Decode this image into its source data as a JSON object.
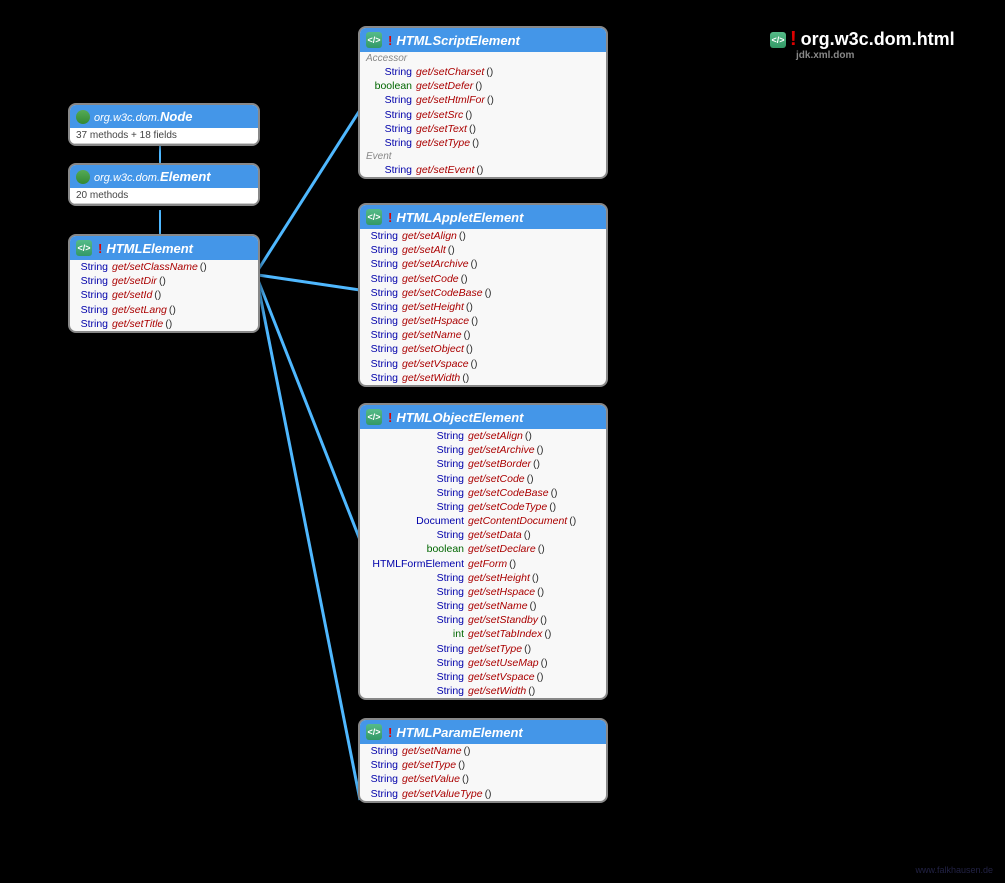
{
  "package_title": "org.w3c.dom.html",
  "package_sub": "jdk.xml.dom",
  "watermark": "www.falkhausen.de",
  "nodes": {
    "node": {
      "prefix": "org.w3c.dom.",
      "name": "Node",
      "sub": "37 methods + 18 fields"
    },
    "element": {
      "prefix": "org.w3c.dom.",
      "name": "Element",
      "sub": "20 methods"
    },
    "htmlelement": {
      "name": "HTMLElement",
      "methods": [
        {
          "type": "String",
          "name": "get/setClassName",
          "prim": false
        },
        {
          "type": "String",
          "name": "get/setDir",
          "prim": false
        },
        {
          "type": "String",
          "name": "get/setId",
          "prim": false
        },
        {
          "type": "String",
          "name": "get/setLang",
          "prim": false
        },
        {
          "type": "String",
          "name": "get/setTitle",
          "prim": false
        }
      ]
    },
    "script": {
      "name": "HTMLScriptElement",
      "sections": [
        {
          "label": "Accessor",
          "methods": [
            {
              "type": "String",
              "name": "get/setCharset",
              "prim": false
            },
            {
              "type": "boolean",
              "name": "get/setDefer",
              "prim": true
            },
            {
              "type": "String",
              "name": "get/setHtmlFor",
              "prim": false
            },
            {
              "type": "String",
              "name": "get/setSrc",
              "prim": false
            },
            {
              "type": "String",
              "name": "get/setText",
              "prim": false
            },
            {
              "type": "String",
              "name": "get/setType",
              "prim": false
            }
          ]
        },
        {
          "label": "Event",
          "methods": [
            {
              "type": "String",
              "name": "get/setEvent",
              "prim": false
            }
          ]
        }
      ]
    },
    "applet": {
      "name": "HTMLAppletElement",
      "methods": [
        {
          "type": "String",
          "name": "get/setAlign",
          "prim": false
        },
        {
          "type": "String",
          "name": "get/setAlt",
          "prim": false
        },
        {
          "type": "String",
          "name": "get/setArchive",
          "prim": false
        },
        {
          "type": "String",
          "name": "get/setCode",
          "prim": false
        },
        {
          "type": "String",
          "name": "get/setCodeBase",
          "prim": false
        },
        {
          "type": "String",
          "name": "get/setHeight",
          "prim": false
        },
        {
          "type": "String",
          "name": "get/setHspace",
          "prim": false
        },
        {
          "type": "String",
          "name": "get/setName",
          "prim": false
        },
        {
          "type": "String",
          "name": "get/setObject",
          "prim": false
        },
        {
          "type": "String",
          "name": "get/setVspace",
          "prim": false
        },
        {
          "type": "String",
          "name": "get/setWidth",
          "prim": false
        }
      ]
    },
    "object": {
      "name": "HTMLObjectElement",
      "methods": [
        {
          "type": "String",
          "name": "get/setAlign",
          "prim": false
        },
        {
          "type": "String",
          "name": "get/setArchive",
          "prim": false
        },
        {
          "type": "String",
          "name": "get/setBorder",
          "prim": false
        },
        {
          "type": "String",
          "name": "get/setCode",
          "prim": false
        },
        {
          "type": "String",
          "name": "get/setCodeBase",
          "prim": false
        },
        {
          "type": "String",
          "name": "get/setCodeType",
          "prim": false
        },
        {
          "type": "Document",
          "name": "getContentDocument",
          "prim": false
        },
        {
          "type": "String",
          "name": "get/setData",
          "prim": false
        },
        {
          "type": "boolean",
          "name": "get/setDeclare",
          "prim": true
        },
        {
          "type": "HTMLFormElement",
          "name": "getForm",
          "prim": false
        },
        {
          "type": "String",
          "name": "get/setHeight",
          "prim": false
        },
        {
          "type": "String",
          "name": "get/setHspace",
          "prim": false
        },
        {
          "type": "String",
          "name": "get/setName",
          "prim": false
        },
        {
          "type": "String",
          "name": "get/setStandby",
          "prim": false
        },
        {
          "type": "int",
          "name": "get/setTabIndex",
          "prim": true
        },
        {
          "type": "String",
          "name": "get/setType",
          "prim": false
        },
        {
          "type": "String",
          "name": "get/setUseMap",
          "prim": false
        },
        {
          "type": "String",
          "name": "get/setVspace",
          "prim": false
        },
        {
          "type": "String",
          "name": "get/setWidth",
          "prim": false
        }
      ]
    },
    "param": {
      "name": "HTMLParamElement",
      "methods": [
        {
          "type": "String",
          "name": "get/setName",
          "prim": false
        },
        {
          "type": "String",
          "name": "get/setType",
          "prim": false
        },
        {
          "type": "String",
          "name": "get/setValue",
          "prim": false
        },
        {
          "type": "String",
          "name": "get/setValueType",
          "prim": false
        }
      ]
    }
  }
}
